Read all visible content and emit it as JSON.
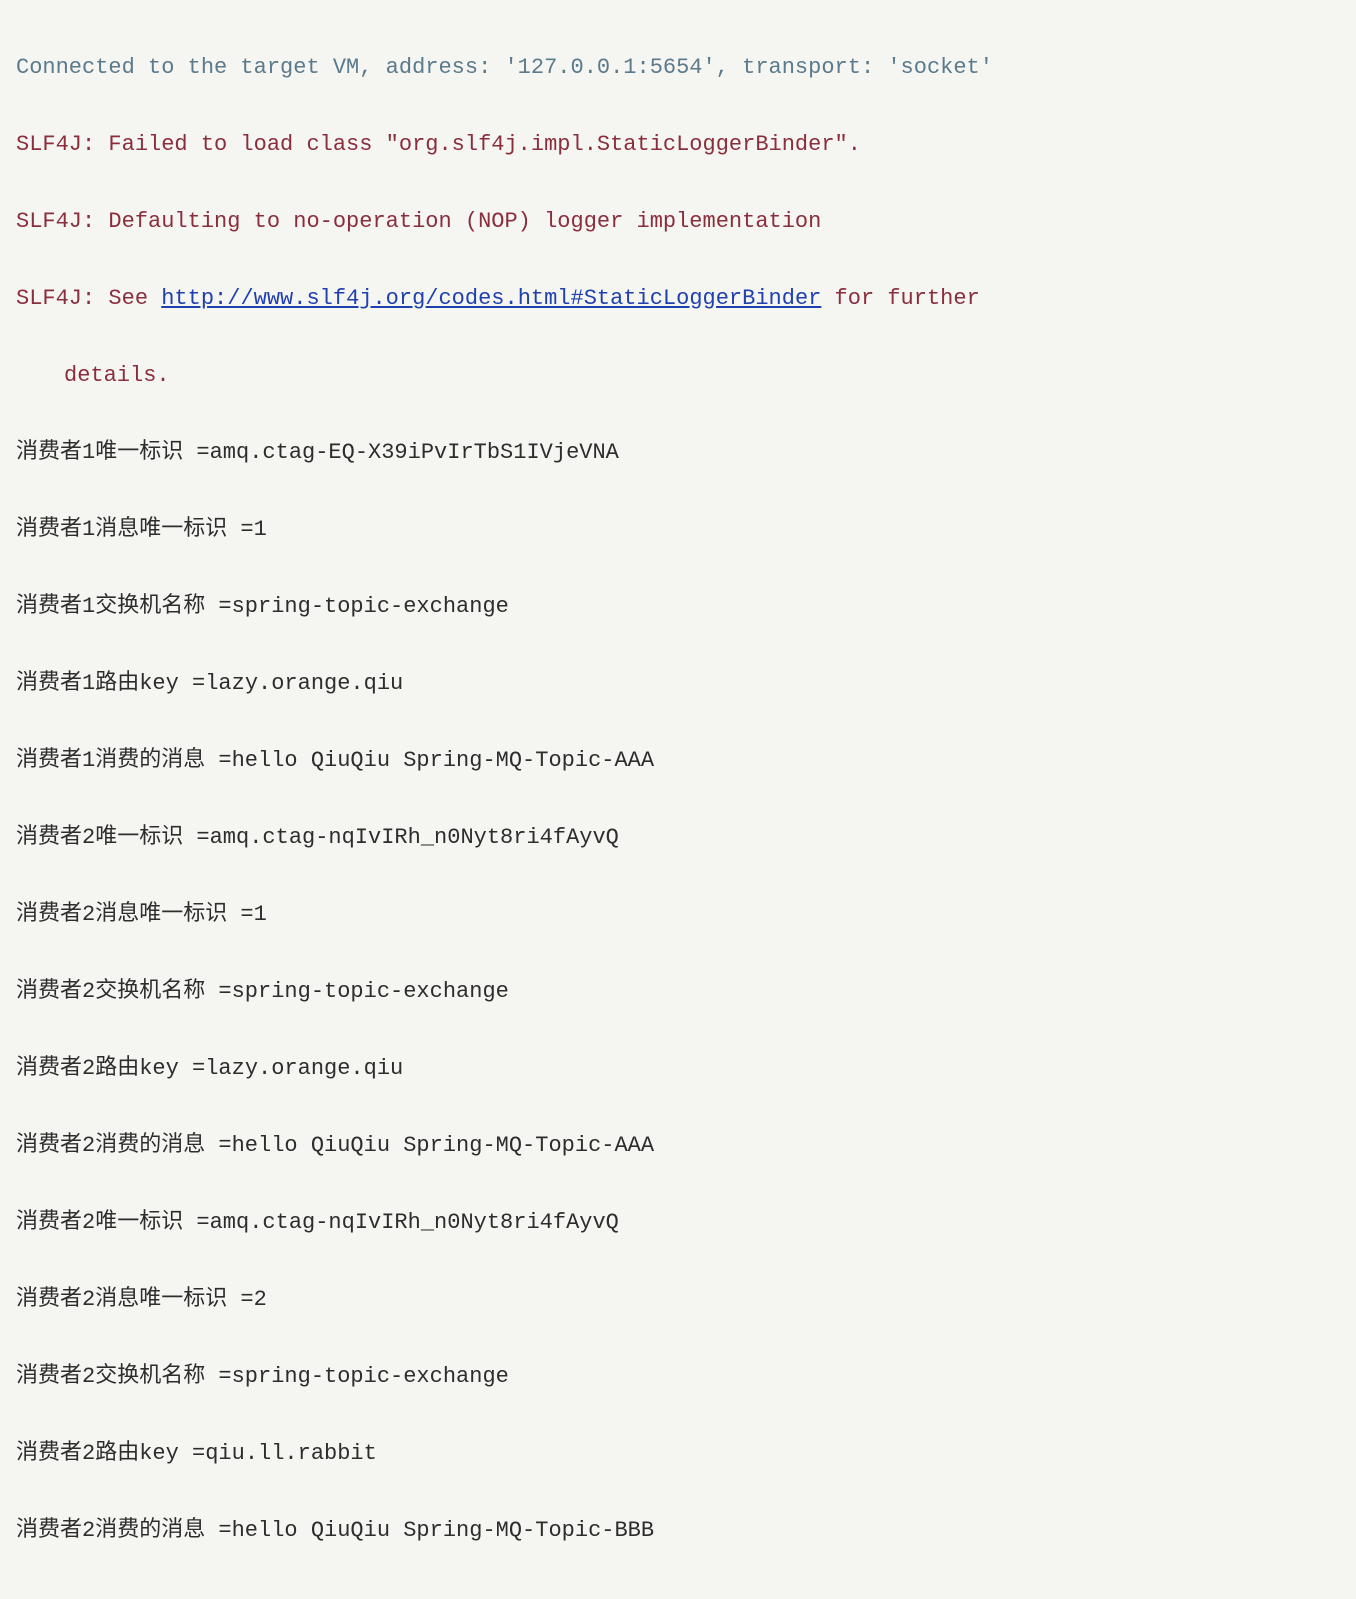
{
  "console": {
    "line1": "Connected to the target VM, address: '127.0.0.1:5654', transport: 'socket'",
    "line2": "SLF4J: Failed to load class \"org.slf4j.impl.StaticLoggerBinder\".",
    "line3": "SLF4J: Defaulting to no-operation (NOP) logger implementation",
    "line4_pre": "SLF4J: See ",
    "line4_link": "http://www.slf4j.org/codes.html#StaticLoggerBinder",
    "line4_post": " for further",
    "line5": "details.",
    "line6": "消费者1唯一标识 =amq.ctag-EQ-X39iPvIrTbS1IVjeVNA",
    "line7": "消费者1消息唯一标识 =1",
    "line8": "消费者1交换机名称 =spring-topic-exchange",
    "line9": "消费者1路由key =lazy.orange.qiu",
    "line10": "消费者1消费的消息 =hello QiuQiu Spring-MQ-Topic-AAA",
    "line11": "消费者2唯一标识 =amq.ctag-nqIvIRh_n0Nyt8ri4fAyvQ",
    "line12": "消费者2消息唯一标识 =1",
    "line13": "消费者2交换机名称 =spring-topic-exchange",
    "line14": "消费者2路由key =lazy.orange.qiu",
    "line15": "消费者2消费的消息 =hello QiuQiu Spring-MQ-Topic-AAA",
    "line16": "消费者2唯一标识 =amq.ctag-nqIvIRh_n0Nyt8ri4fAyvQ",
    "line17": "消费者2消息唯一标识 =2",
    "line18": "消费者2交换机名称 =spring-topic-exchange",
    "line19": "消费者2路由key =qiu.ll.rabbit",
    "line20": "消费者2消费的消息 =hello QiuQiu Spring-MQ-Topic-BBB"
  }
}
